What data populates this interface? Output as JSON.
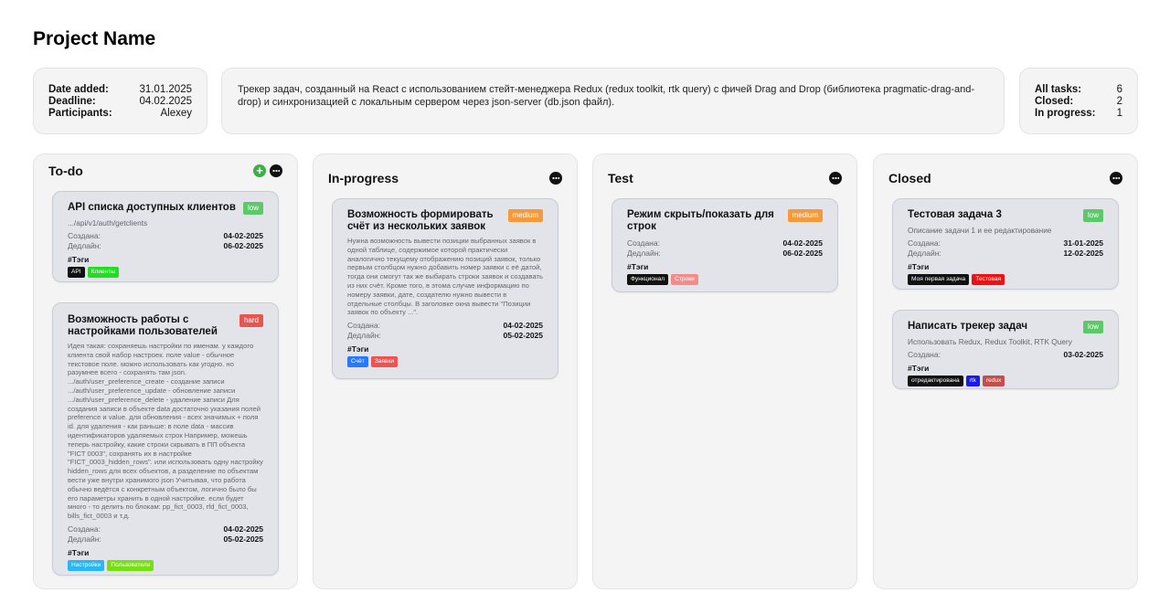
{
  "project": {
    "title": "Project Name",
    "meta": [
      {
        "label": "Date added:",
        "value": "31.01.2025"
      },
      {
        "label": "Deadline:",
        "value": "04.02.2025"
      },
      {
        "label": "Participants:",
        "value": "Alexey"
      }
    ],
    "description": "Трекер задач, созданный на React с использованием стейт-менеджера Redux (redux toolkit, rtk query) с фичей Drag and Drop (библиотека pragmatic-drag-and-drop) и синхронизацией с локальным сервером через json-server (db.json файл).",
    "stats": [
      {
        "label": "All tasks:",
        "value": "6"
      },
      {
        "label": "Closed:",
        "value": "2"
      },
      {
        "label": "In progress:",
        "value": "1"
      }
    ]
  },
  "icons": {
    "add": "plus-icon",
    "more": "more-icon"
  },
  "labels": {
    "created": "Создана:",
    "deadline": "Дедлайн:",
    "tags": "#Тэги"
  },
  "columns": [
    {
      "title": "To-do",
      "tasks": [
        {
          "title": "API списка доступных клиентов",
          "priority": "low",
          "description": ".../api/v1/auth/getclients",
          "created": "04-02-2025",
          "deadline": "06-02-2025",
          "tags": [
            {
              "name": "API",
              "color": "#111111"
            },
            {
              "name": "Клиенты",
              "color": "#22dd22"
            }
          ]
        },
        {
          "title": "Возможность работы с настройками пользователей",
          "priority": "hard",
          "description": "Идея такая: сохраняешь настройки по именам. у каждого клиента свой набор настроек. поле value - обычное текстовое поле. можно использовать как угодно. но разумнее всего - сохранять там json. .../auth/user_preference_create - создание записи .../auth/user_preference_update - обновление записи .../auth/user_preference_delete - удаление записи Для создания записи в объекте data достаточно указания полей preference и value. для обновления - всех значимых + поля id. для удаления - как раньше: в поле data - массив идентификаторов удаляемых строк Например, можешь теперь настройку, какие строки скрывать в ПП объекта \"FICT 0003\", сохранять их в настройке \"FICT_0003_hidden_rows\". или использовать одну настройку hidden_rows для всех объектов, а разделение по объектам вести уже внутри хранимого json Учитывая, что работа обычно ведётся с конкретным объектом, логично было бы его параметры хранить в одной настройке. если будет много - то делить по блокам: pp_fict_0003, rfd_fict_0003, bills_fict_0003 и т.д.",
          "created": "04-02-2025",
          "deadline": "05-02-2025",
          "tags": [
            {
              "name": "Настройки",
              "color": "#29b6f6"
            },
            {
              "name": "Пользователи",
              "color": "#76e012"
            }
          ]
        }
      ]
    },
    {
      "title": "In-progress",
      "tasks": [
        {
          "title": "Возможность формировать счёт из нескольких заявок",
          "priority": "medium",
          "description": "Нужна возможность вывести позиции выбранных заявок в одной таблице, содержимое которой практически аналогично текущему отображению позиций заявок, только первым столбцом нужно добавить номер заявки с её датой, тогда они смогут так же выбирать строки заявок и создавать из них счёт. Кроме того, в этома случае информацию по номеру заявки, дате, создателю нужно вывести в отдельные столбцы. В заголовке окна вывести \"Позиции заявок по объекту ...\".",
          "created": "04-02-2025",
          "deadline": "05-02-2025",
          "tags": [
            {
              "name": "Счёт",
              "color": "#2979ff"
            },
            {
              "name": "Заявки",
              "color": "#ef5350"
            }
          ]
        }
      ]
    },
    {
      "title": "Test",
      "tasks": [
        {
          "title": "Режим скрыть/показать для строк",
          "priority": "medium",
          "description": "",
          "created": "04-02-2025",
          "deadline": "06-02-2025",
          "tags": [
            {
              "name": "Функционал",
              "color": "#111111"
            },
            {
              "name": "Строки",
              "color": "#f48a8a"
            }
          ]
        }
      ]
    },
    {
      "title": "Closed",
      "tasks": [
        {
          "title": "Тестовая задача 3",
          "priority": "low",
          "description": "Описание задачи 1 и ее редактирование",
          "created": "31-01-2025",
          "deadline": "12-02-2025",
          "tags": [
            {
              "name": "Моя первая задача",
              "color": "#111111"
            },
            {
              "name": "Тестовая",
              "color": "#ee1111"
            }
          ]
        },
        {
          "title": "Написать трекер задач",
          "priority": "low",
          "description": "Использовать Redux, Redux Toolkit, RTK Query",
          "created": "03-02-2025",
          "deadline": "",
          "tags": [
            {
              "name": "отредактирована",
              "color": "#111111"
            },
            {
              "name": "rtk",
              "color": "#1a1aee"
            },
            {
              "name": "redux",
              "color": "#c0504d"
            }
          ]
        }
      ]
    }
  ]
}
